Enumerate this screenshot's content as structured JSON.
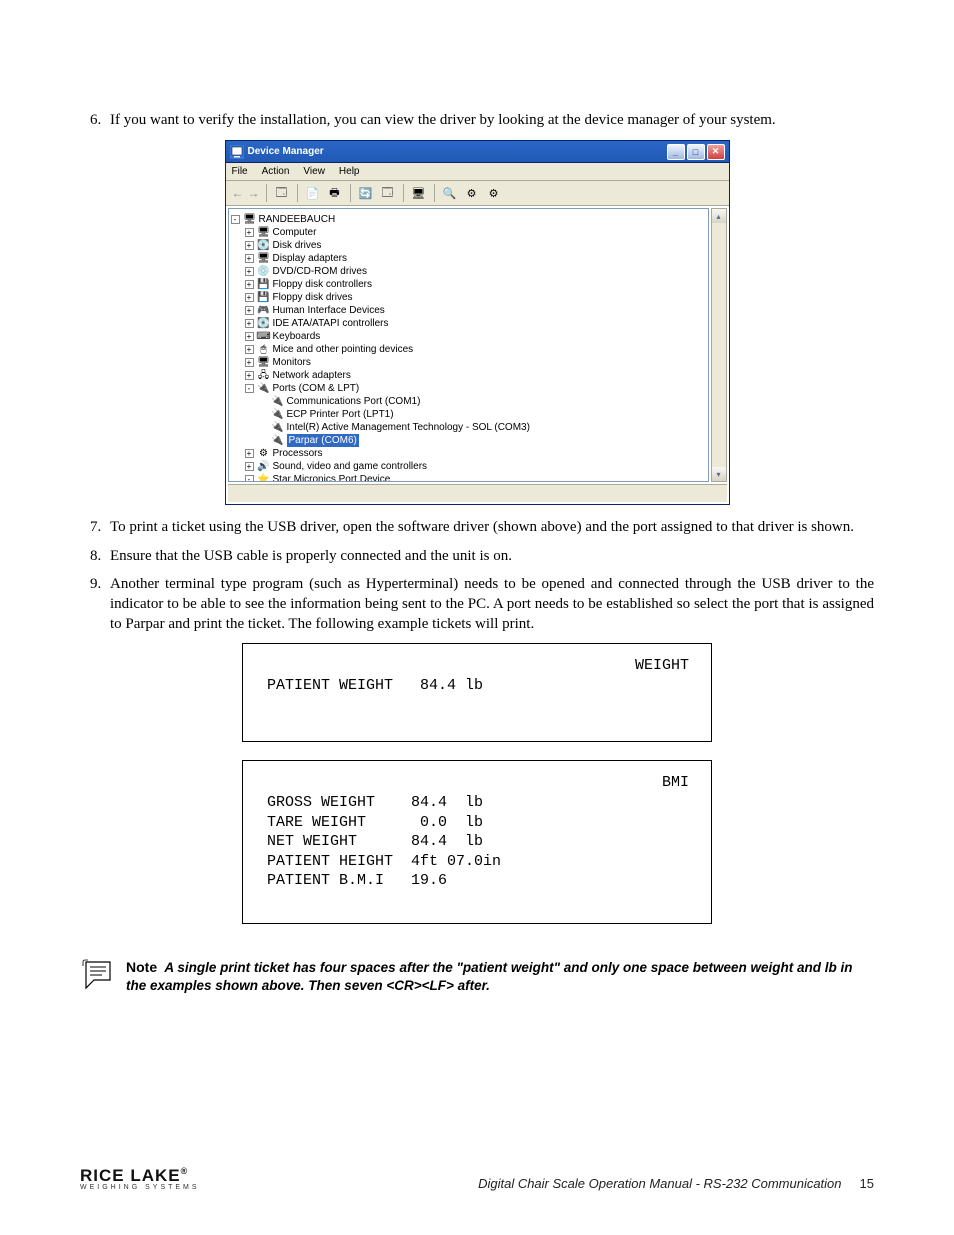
{
  "instructions": {
    "i6": {
      "num": "6.",
      "text": "If you want to verify the installation, you can view the driver by looking at the device manager of your system."
    },
    "i7": {
      "num": "7.",
      "text": "To print a ticket using the USB driver, open the software driver (shown above) and the port assigned to that driver is shown."
    },
    "i8": {
      "num": "8.",
      "text": "Ensure that the USB cable is properly connected and the unit is on."
    },
    "i9": {
      "num": "9.",
      "text": "Another terminal type program (such as Hyperterminal) needs to be opened and connected through the USB driver to the indicator to be able to see the information being sent to the PC. A port needs to be established so select the port that is assigned to Parpar and print the ticket. The following example tickets will print."
    }
  },
  "device_manager": {
    "title": "Device Manager",
    "menu": {
      "file": "File",
      "action": "Action",
      "view": "View",
      "help": "Help"
    },
    "root": "RANDEEBAUCH",
    "nodes": {
      "computer": "Computer",
      "disk": "Disk drives",
      "display": "Display adapters",
      "dvd": "DVD/CD-ROM drives",
      "floppyctrl": "Floppy disk controllers",
      "floppydrv": "Floppy disk drives",
      "hid": "Human Interface Devices",
      "ide": "IDE ATA/ATAPI controllers",
      "keyboards": "Keyboards",
      "mice": "Mice and other pointing devices",
      "monitors": "Monitors",
      "network": "Network adapters",
      "ports": "Ports (COM & LPT)",
      "com1": "Communications Port (COM1)",
      "lpt1": "ECP Printer Port (LPT1)",
      "sol": "Intel(R) Active Management Technology - SOL (COM3)",
      "parpar": "Parpar (COM6)",
      "processors": "Processors",
      "sound": "Sound, video and game controllers",
      "star": "Star Micronics Port Device"
    }
  },
  "ticket_weight": {
    "label": "WEIGHT",
    "row1_label": "PATIENT WEIGHT",
    "row1_value": "84.4 lb"
  },
  "ticket_bmi": {
    "label": "BMI",
    "rows": {
      "gross_l": "GROSS WEIGHT",
      "gross_v": "84.4  lb",
      "tare_l": "TARE WEIGHT",
      "tare_v": " 0.0  lb",
      "net_l": "NET WEIGHT",
      "net_v": "84.4  lb",
      "ph_l": "PATIENT HEIGHT",
      "ph_v": "4ft 07.0in",
      "bmi_l": "PATIENT B.M.I",
      "bmi_v": "19.6"
    }
  },
  "note": {
    "word": "Note",
    "text": "A single print ticket has four spaces after the \"patient weight\" and only one space between weight and lb in the examples shown above. Then seven <CR><LF> after."
  },
  "footer": {
    "brand_top": "RICE LAKE",
    "brand_sub": "WEIGHING SYSTEMS",
    "doc_title": "Digital Chair Scale Operation Manual - RS-232 Communication",
    "page": "15"
  }
}
